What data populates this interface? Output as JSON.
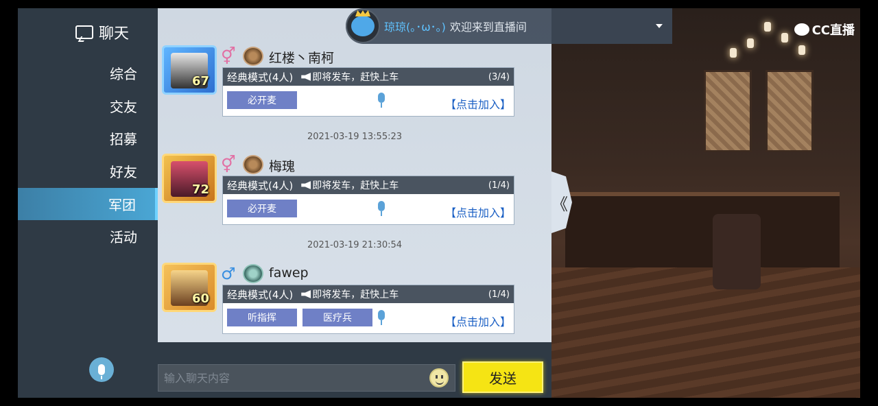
{
  "sidebar": {
    "title": "聊天",
    "items": [
      {
        "label": "综合",
        "active": false
      },
      {
        "label": "交友",
        "active": false
      },
      {
        "label": "招募",
        "active": false
      },
      {
        "label": "好友",
        "active": false
      },
      {
        "label": "军团",
        "active": true
      },
      {
        "label": "活动",
        "active": false
      }
    ]
  },
  "notice": {
    "user": "琼琼(｡･ω･｡)",
    "text": "欢迎来到直播间"
  },
  "messages": [
    {
      "name": "红楼丶南柯",
      "level": "67",
      "gender": "⚥",
      "mode": "经典模式(4人)",
      "notice": "即将发车，赶快上车",
      "count": "(3/4)",
      "tags": [
        "必开麦"
      ],
      "join": "【点击加入】"
    },
    {
      "name": "梅瑰",
      "level": "72",
      "gender": "⚥",
      "mode": "经典模式(4人)",
      "notice": "即将发车，赶快上车",
      "count": "(1/4)",
      "tags": [
        "必开麦"
      ],
      "join": "【点击加入】"
    },
    {
      "name": "fawep",
      "level": "60",
      "gender": "♂",
      "mode": "经典模式(4人)",
      "notice": "即将发车，赶快上车",
      "count": "(1/4)",
      "tags": [
        "听指挥",
        "医疗兵"
      ],
      "join": "【点击加入】"
    }
  ],
  "timestamps": [
    "2021-03-19 13:55:23",
    "2021-03-19 21:30:54"
  ],
  "input": {
    "placeholder": "输入聊天内容",
    "value": ""
  },
  "send_label": "发送",
  "watermark": "CC直播",
  "collapse_label": "《"
}
